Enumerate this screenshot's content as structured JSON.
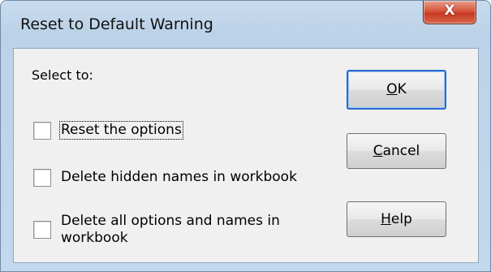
{
  "window": {
    "title": "Reset to Default Warning",
    "close_glyph": "X"
  },
  "dialog": {
    "prompt": "Select to:",
    "options": [
      {
        "label": "Reset the options",
        "checked": false
      },
      {
        "label": "Delete hidden names in workbook",
        "checked": false
      },
      {
        "label": "Delete all options and names in workbook",
        "checked": false
      }
    ],
    "buttons": {
      "ok": {
        "mnemonic": "O",
        "rest": "K"
      },
      "cancel": {
        "mnemonic": "C",
        "rest": "ancel"
      },
      "help": {
        "mnemonic": "H",
        "rest": "elp"
      }
    }
  },
  "icons": {
    "close": "close-icon"
  },
  "colors": {
    "client_bg": "#f0f0f0",
    "default_button_border": "#2a6ad0",
    "close_button_red": "#c43b22"
  }
}
